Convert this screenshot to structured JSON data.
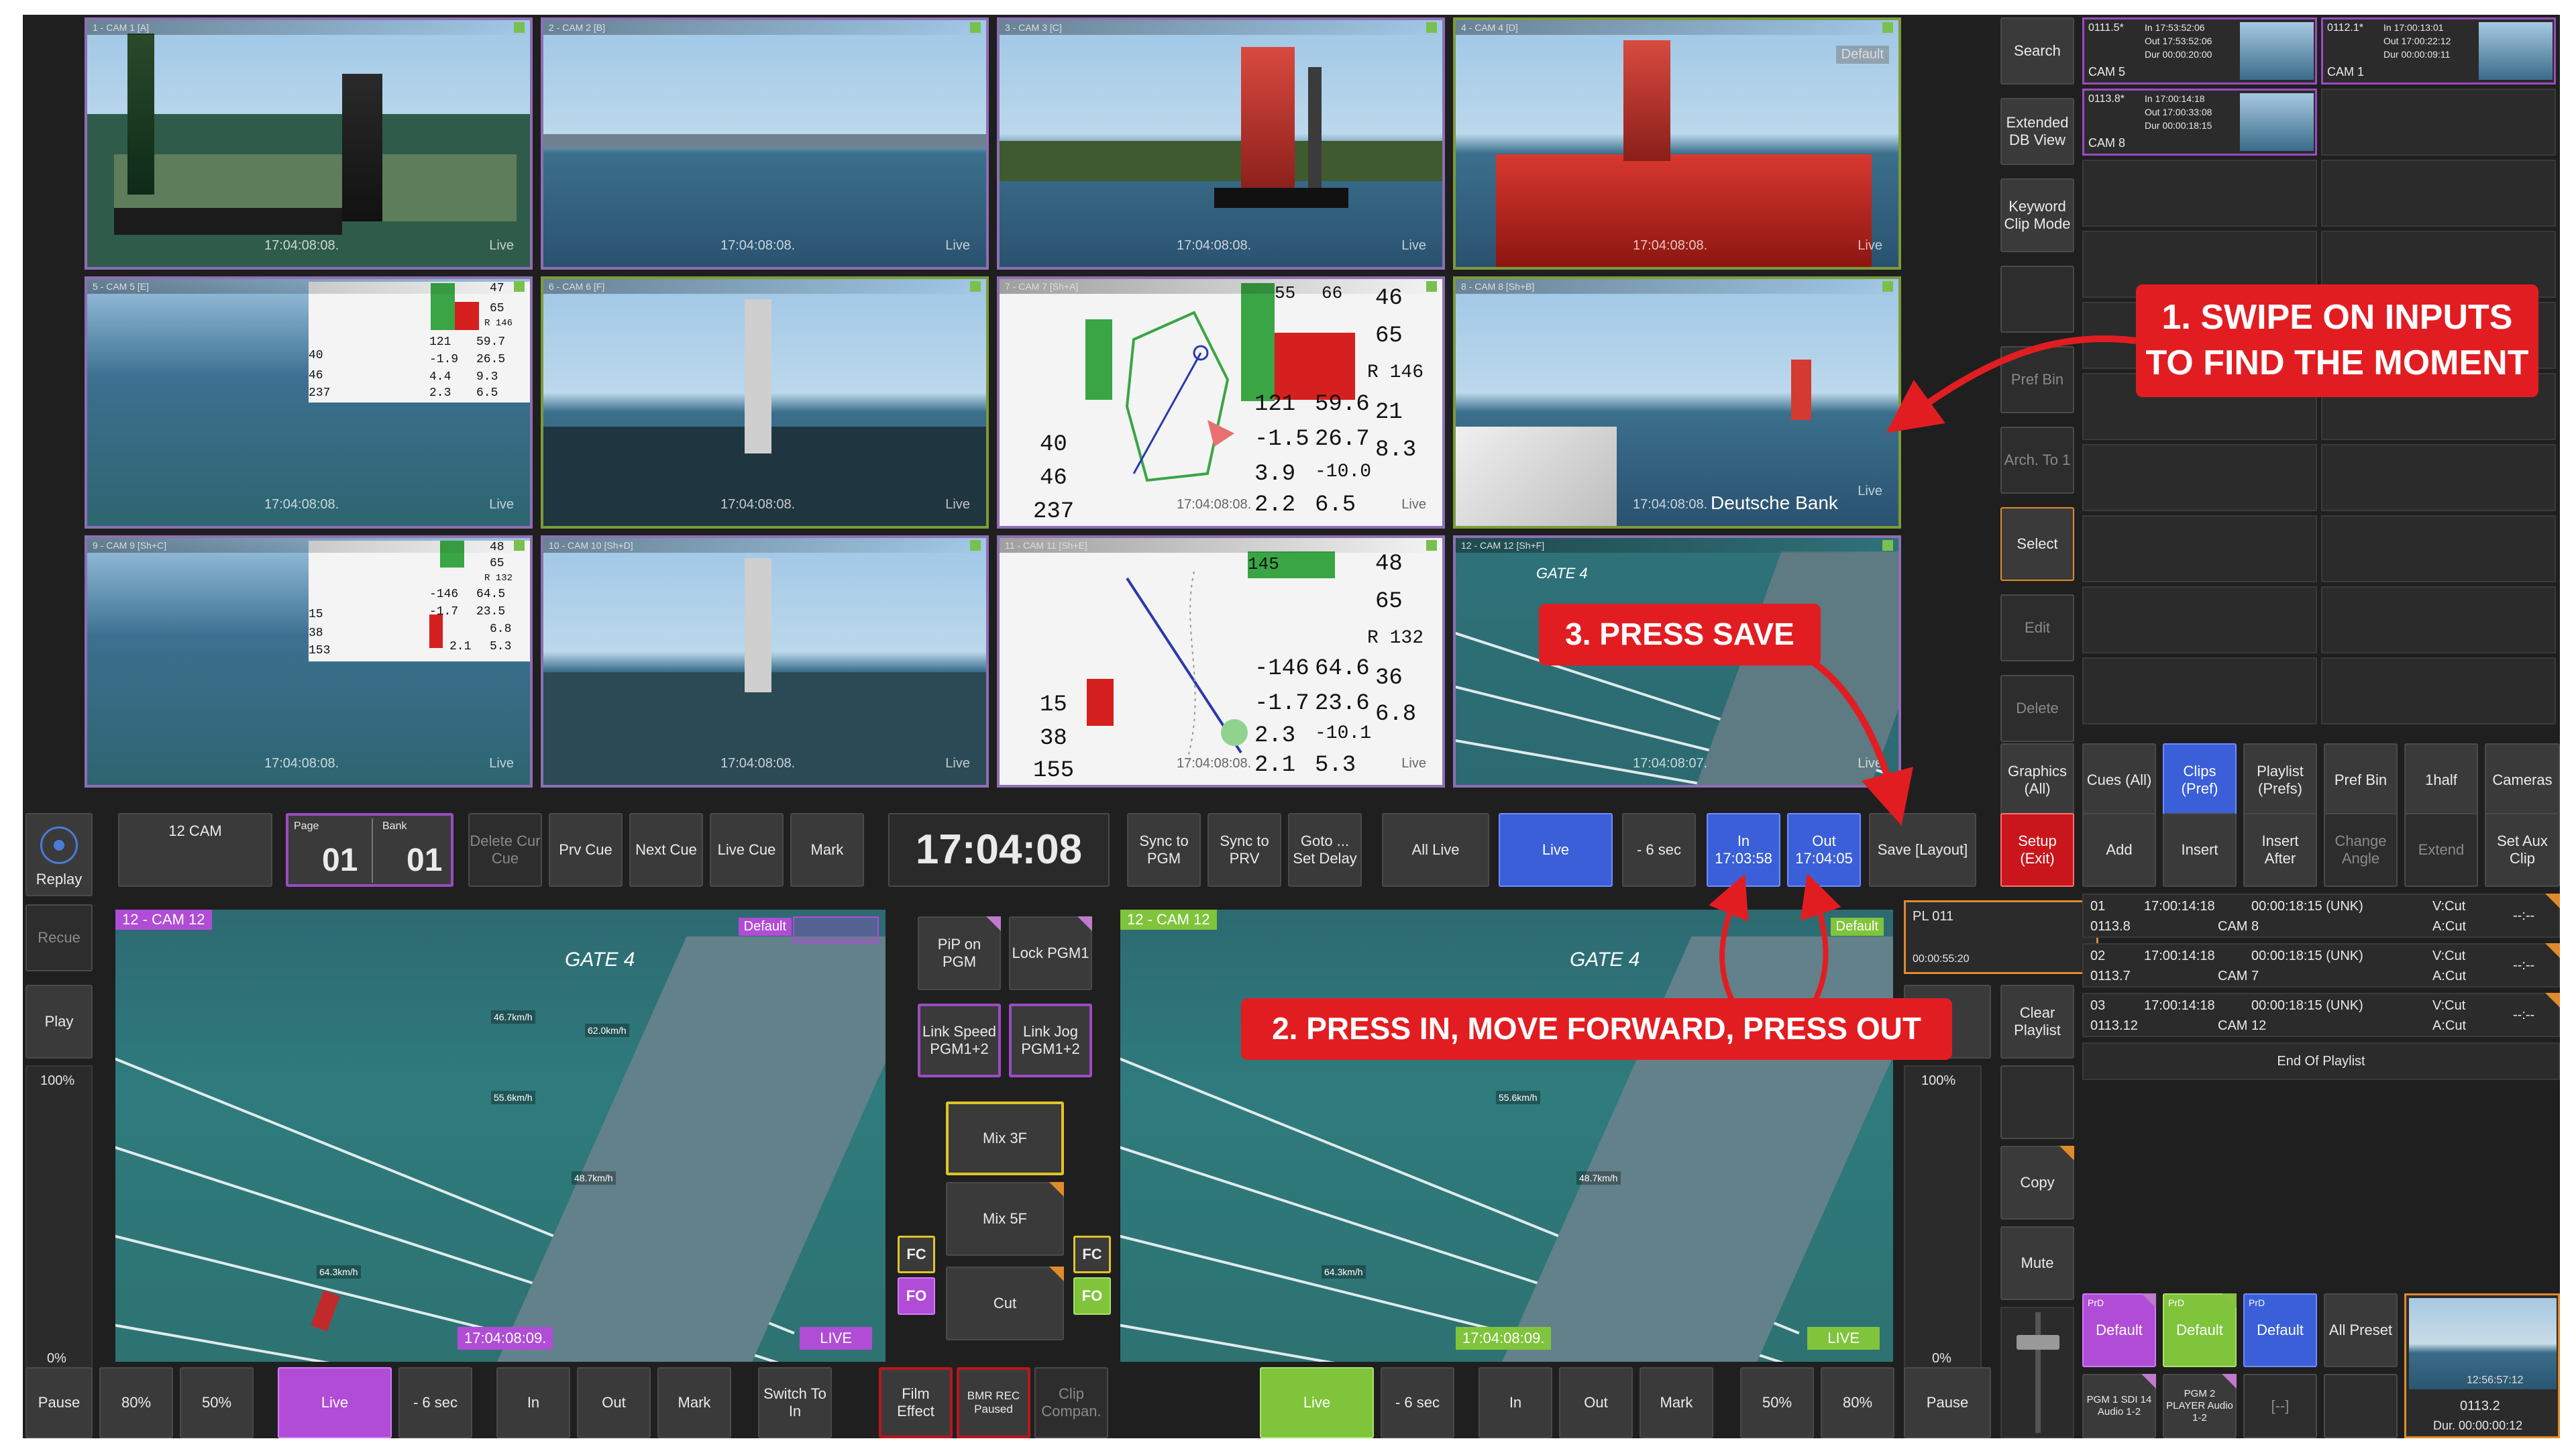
{
  "cams": [
    {
      "label": "1 - CAM 1 [A]",
      "time": "17:04:08:08.",
      "live": "Live"
    },
    {
      "label": "2 - CAM 2 [B]",
      "time": "17:04:08:08.",
      "live": "Live"
    },
    {
      "label": "3 - CAM 3 [C]",
      "time": "17:04:08:08.",
      "live": "Live"
    },
    {
      "label": "4 - CAM 4 [D]",
      "time": "17:04:08:08.",
      "live": "Live",
      "tag": "Default"
    },
    {
      "label": "5 - CAM 5 [E]",
      "time": "17:04:08:08.",
      "live": "Live"
    },
    {
      "label": "6 - CAM 6 [F]",
      "time": "17:04:08:08.",
      "live": "Live"
    },
    {
      "label": "7 - CAM 7 [Sh+A]",
      "time": "17:04:08:08.",
      "live": "Live"
    },
    {
      "label": "8 - CAM 8 [Sh+B]",
      "time": "17:04:08:08.",
      "live": "Live",
      "brand": "Deutsche Bank"
    },
    {
      "label": "9 - CAM 9 [Sh+C]",
      "time": "17:04:08:08.",
      "live": "Live"
    },
    {
      "label": "10 - CAM 10 [Sh+D]",
      "time": "17:04:08:08.",
      "live": "Live"
    },
    {
      "label": "11 - CAM 11 [Sh+E]",
      "time": "17:04:08:08.",
      "live": "Live"
    },
    {
      "label": "12 - CAM 12 [Sh+F]",
      "time": "17:04:08:07.",
      "live": "Live",
      "gate": "GATE 4"
    }
  ],
  "telemetry": {
    "big1": {
      "a": "46",
      "b": "65",
      "c": "R 146",
      "d": "21",
      "e": "8.3",
      "f": "121",
      "g": "59.6",
      "h": "-1.5",
      "i": "26.7",
      "j": "3.9",
      "k": "-10.0",
      "l": "2.2",
      "m": "6.5",
      "n": "40",
      "o": "46",
      "p": "237",
      "q": "55",
      "r": "66"
    },
    "big2": {
      "a": "48",
      "b": "65",
      "c": "R 132",
      "d": "36",
      "e": "6.8",
      "f": "-146",
      "g": "64.6",
      "h": "-1.7",
      "i": "23.6",
      "j": "2.3",
      "k": "-10.1",
      "l": "2.1",
      "m": "5.3",
      "n": "15",
      "o": "38",
      "p": "155",
      "q": "145"
    },
    "small1": {
      "a": "47",
      "b": "65",
      "c": "R 146",
      "d": "121",
      "e": "59.7",
      "f": "-1.9",
      "g": "26.5",
      "h": "4.4",
      "i": "9.3",
      "j": "2.3",
      "k": "6.5",
      "l": "40",
      "m": "46",
      "n": "237"
    },
    "small2": {
      "a": "48",
      "b": "65",
      "c": "R 132",
      "d": "-146",
      "e": "64.5",
      "f": "-1.7",
      "g": "23.5",
      "h": "2.1",
      "i": "5.3",
      "j": "6.8",
      "k": "15",
      "l": "38",
      "m": "153"
    }
  },
  "right_top": {
    "search": "Search",
    "extended": "Extended DB View",
    "keyword": "Keyword Clip Mode",
    "pref_bin": "Pref Bin",
    "arch": "Arch. To 1",
    "select": "Select",
    "edit": "Edit",
    "delete": "Delete",
    "clips": [
      {
        "id": "0111.5*",
        "in": "In 17:53:52:06",
        "out": "Out 17:53:52:06",
        "dur": "Dur 00:00:20:00",
        "cam": "CAM 5"
      },
      {
        "id": "0112.1*",
        "in": "In 17:00:13:01",
        "out": "Out 17:00:22:12",
        "dur": "Dur 00:00:09:11",
        "cam": "CAM 1"
      },
      {
        "id": "0113.8*",
        "in": "In 17:00:14:18",
        "out": "Out 17:00:33:08",
        "dur": "Dur 00:00:18:15",
        "cam": "CAM 8"
      }
    ]
  },
  "tabs": {
    "graphics": "Graphics (All)",
    "cues": "Cues (All)",
    "clips": "Clips (Pref)",
    "playlist": "Playlist (Prefs)",
    "pref_bin": "Pref Bin",
    "half": "1half",
    "cameras": "Cameras"
  },
  "control_row": {
    "replay": "Replay",
    "cam12": "12 CAM",
    "page_label": "Page",
    "page": "01",
    "bank_label": "Bank",
    "bank": "01",
    "delete_cue": "Delete Cur Cue",
    "prv_cue": "Prv Cue",
    "next_cue": "Next Cue",
    "live_cue": "Live Cue",
    "mark": "Mark",
    "timecode": "17:04:08",
    "sync_pgm": "Sync to PGM",
    "sync_prv": "Sync to PRV",
    "goto": "Goto ... Set Delay",
    "all_live": "All Live",
    "live": "Live",
    "minus6": "- 6 sec",
    "in": "In",
    "in_tc": "17:03:58",
    "out": "Out",
    "out_tc": "17:04:05",
    "save": "Save [Layout]",
    "setup": "Setup (Exit)",
    "add": "Add",
    "insert": "Insert",
    "insert_after": "Insert After",
    "change_angle": "Change Angle",
    "extend": "Extend",
    "set_aux": "Set Aux Clip"
  },
  "left_side": {
    "recue": "Recue",
    "play": "Play",
    "speed": "100%",
    "zero": "0%"
  },
  "pgm1": {
    "label": "12 - CAM 12",
    "tag": "Default",
    "time": "17:04:08:09.",
    "live": "LIVE",
    "gate": "GATE 4"
  },
  "pgm2": {
    "label": "12 - CAM 12",
    "tag": "Default",
    "time": "17:04:08:09.",
    "live": "LIVE",
    "gate": "GATE 4"
  },
  "boat_tags": {
    "a": "46.7km/h",
    "b": "62.0km/h",
    "c": "55.6km/h",
    "d": "48.7km/h",
    "e": "64.3km/h"
  },
  "center": {
    "pip": "PiP on PGM",
    "lock": "Lock PGM1",
    "link_speed": "Link Speed PGM1+2",
    "link_jog": "Link Jog PGM1+2",
    "mix3": "Mix 3F",
    "mix5": "Mix 5F",
    "cut": "Cut",
    "fc": "FC",
    "fo": "FO"
  },
  "playlist": {
    "name": "PL 011",
    "count": "3",
    "dur": "00:00:55:20",
    "clear": "Clear Playlist",
    "speed": "100%",
    "zero": "0%",
    "rows": [
      {
        "n": "01",
        "tc": "17:00:14:18",
        "dur": "00:00:18:15 (UNK)",
        "tr": "V:Cut",
        "id": "0113.8",
        "cam": "CAM 8",
        "tr2": "A:Cut",
        "x": "--:--"
      },
      {
        "n": "02",
        "tc": "17:00:14:18",
        "dur": "00:00:18:15 (UNK)",
        "tr": "V:Cut",
        "id": "0113.7",
        "cam": "CAM 7",
        "tr2": "A:Cut",
        "x": "--:--"
      },
      {
        "n": "03",
        "tc": "17:00:14:18",
        "dur": "00:00:18:15 (UNK)",
        "tr": "V:Cut",
        "id": "0113.12",
        "cam": "CAM 12",
        "tr2": "A:Cut",
        "x": "--:--"
      }
    ],
    "end": "End Of Playlist"
  },
  "right_bottom": {
    "copy": "Copy",
    "mute": "Mute",
    "prd": "PrD",
    "default": "Default",
    "all_preset": "All Preset",
    "pgm1": "PGM 1 SDI 14 Audio 1-2",
    "pgm2": "PGM 2 PLAYER Audio 1-2",
    "dash": "[--]",
    "thumb_time": "12:56:57:12",
    "thumb_id": "0113.2",
    "thumb_dur": "Dur. 00:00:00:12"
  },
  "bottom_row": {
    "pause": "Pause",
    "p80": "80%",
    "p50": "50%",
    "live": "Live",
    "minus6": "- 6 sec",
    "in": "In",
    "out": "Out",
    "mark": "Mark",
    "switch": "Switch To In",
    "film": "Film Effect",
    "bmr": "BMR REC Paused",
    "clip_comp": "Clip Compan."
  },
  "callouts": {
    "one": "1. SWIPE ON INPUTS TO FIND THE MOMENT",
    "two": "2. PRESS IN, MOVE FORWARD, PRESS OUT",
    "three": "3. PRESS SAVE"
  },
  "colors": {
    "purple": "#b04cd6",
    "green": "#7fc43b",
    "blue": "#3a5fd8",
    "red": "#e21d22",
    "yellow": "#e0c32a"
  }
}
